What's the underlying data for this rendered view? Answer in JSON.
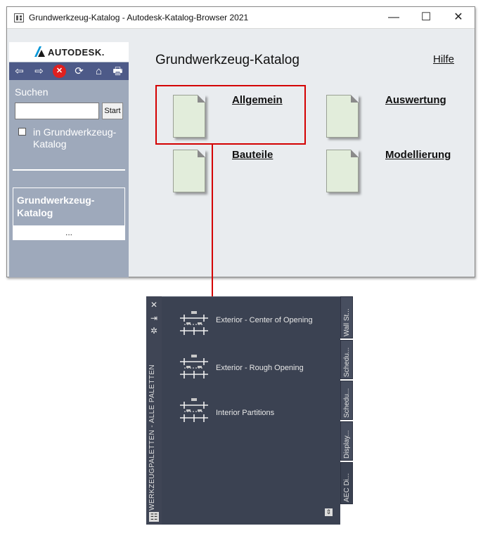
{
  "window": {
    "title": "Grundwerkzeug-Katalog - Autodesk-Katalog-Browser 2021",
    "minimize_glyph": "—",
    "maximize_glyph": "☐",
    "close_glyph": "✕"
  },
  "sidebar": {
    "logo_text": "AUTODESK.",
    "nav_icons": [
      "back-arrow-icon",
      "forward-arrow-icon",
      "stop-icon",
      "refresh-icon",
      "home-icon",
      "print-icon"
    ],
    "nav_glyphs": {
      "back": "⇦",
      "forward": "⇨",
      "stop": "✕",
      "refresh": "⟳",
      "home": "⌂",
      "print": "🖶"
    },
    "search_label": "Suchen",
    "search_value": "",
    "start_label": "Start",
    "in_catalog_label": "in Grundwerkzeug-Katalog",
    "current_catalog": "Grundwerkzeug-Katalog",
    "more": "..."
  },
  "main": {
    "title": "Grundwerkzeug-Katalog",
    "help": "Hilfe",
    "categories": [
      "Allgemein",
      "Auswertung",
      "Bauteile",
      "Modellierung"
    ]
  },
  "palette": {
    "title": "WERKZEUGPALETTEN - ALLE PALETTEN",
    "strip_glyphs": {
      "close": "✕",
      "pin": "⇥",
      "properties": "✲",
      "menu": "☷"
    },
    "tabs": [
      "Wall St...",
      "Schedu...",
      "Schedu...",
      "Display...",
      "AEC Di..."
    ],
    "active_tab": "AEC Di...",
    "tools": [
      {
        "label": "Exterior - Center of Opening"
      },
      {
        "label": "Exterior - Rough Opening"
      },
      {
        "label": "Interior Partitions"
      }
    ],
    "corner_glyph": "⇕"
  },
  "colors": {
    "sidebar": "#9ea9bb",
    "iconbar": "#4d5a88",
    "highlight": "#d40000",
    "palette_bg": "#3b4252",
    "doc_fill": "#e2eddb"
  }
}
